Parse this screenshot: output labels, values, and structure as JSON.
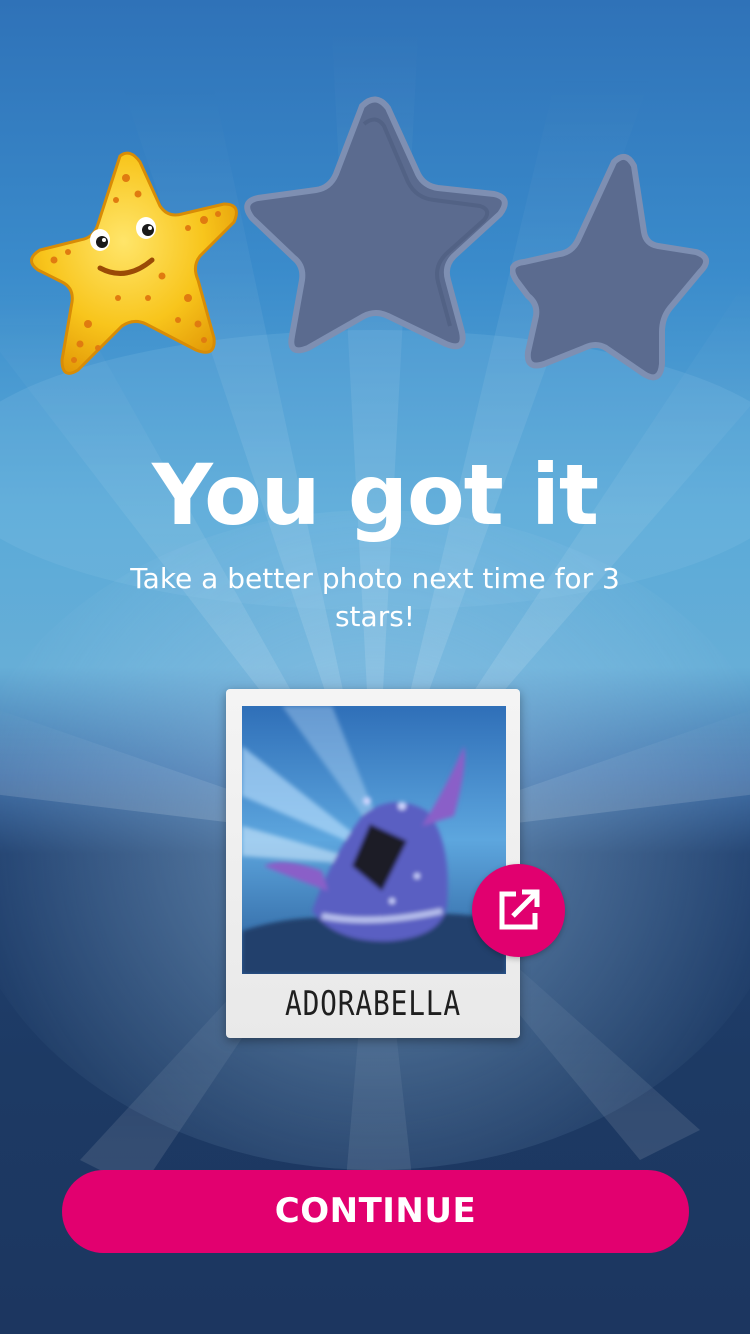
{
  "rating": {
    "earned_stars": 1,
    "total_stars": 3,
    "earned_star_icon": "smiling-starfish-icon",
    "empty_star_icon": "empty-star-slot-icon"
  },
  "result": {
    "title": "You got it",
    "message": "Take a better photo next time for 3 stars!"
  },
  "photo_card": {
    "caption": "ADORABELLA",
    "share_icon": "share-external-icon"
  },
  "actions": {
    "continue_label": "CONTINUE"
  },
  "colors": {
    "accent": "#e2006f",
    "text": "#ffffff",
    "background_top": "#2f72b8",
    "background_bottom": "#1c3660",
    "empty_star": "#5b6b8f",
    "starfish": "#f5b50f"
  }
}
